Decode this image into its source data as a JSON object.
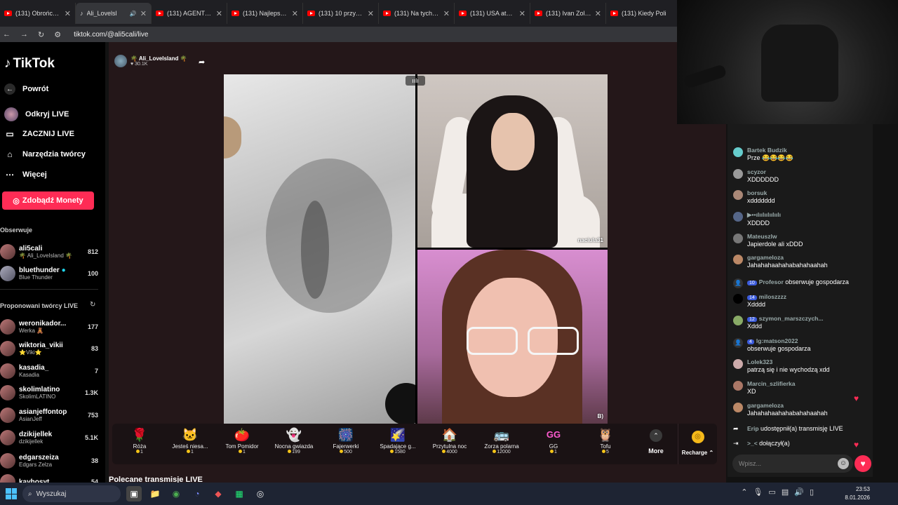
{
  "browser": {
    "tabs": [
      {
        "title": "(131) Obrońcy W",
        "type": "youtube",
        "active": false
      },
      {
        "title": "Ali_Lovelsl",
        "type": "tiktok",
        "active": true
      },
      {
        "title": "(131) AGENT ICE",
        "type": "youtube",
        "active": false
      },
      {
        "title": "(131) Najlepsze T",
        "type": "youtube",
        "active": false
      },
      {
        "title": "(131) 10 przywód",
        "type": "youtube",
        "active": false
      },
      {
        "title": "(131) Na tych prz",
        "type": "youtube",
        "active": false
      },
      {
        "title": "(131) USA atakuj",
        "type": "youtube",
        "active": false
      },
      {
        "title": "(131) Ivan Zolo B",
        "type": "youtube",
        "active": false
      },
      {
        "title": "(131) Kiedy Poli",
        "type": "youtube",
        "active": false
      }
    ],
    "url": "tiktok.com/@ali5cali/live"
  },
  "sidebar": {
    "logo": "TikTok",
    "back": "Powrót",
    "nav": [
      {
        "label": "Odkryj LIVE",
        "icon": "live-avatar-icon"
      },
      {
        "label": "ZACZNIJ LIVE",
        "icon": "video-camera-icon"
      },
      {
        "label": "Narzędzia twórcy",
        "icon": "house-icon"
      },
      {
        "label": "Więcej",
        "icon": "more-dots-icon"
      }
    ],
    "coins_button": "Zdobądź Monety",
    "following_title": "Obserwuje",
    "following": [
      {
        "name": "ali5cali",
        "sub": "🌴 Ali_LoveIsland 🌴",
        "count": "812"
      },
      {
        "name": "bluethunder",
        "sub": "Blue Thunder",
        "count": "100"
      }
    ],
    "suggested_title": "Proponowani twórcy LIVE",
    "suggested": [
      {
        "name": "weronikador...",
        "sub": "Werka 🧸",
        "count": "177"
      },
      {
        "name": "wiktoria_vikii",
        "sub": "⭐Viki⭐",
        "count": "83"
      },
      {
        "name": "kasadia_",
        "sub": "Kasadia",
        "count": "7"
      },
      {
        "name": "skolimlatino",
        "sub": "SkolimLATINO",
        "count": "1.3K"
      },
      {
        "name": "asianjeffontop",
        "sub": "AsianJeff",
        "count": "753"
      },
      {
        "name": "dzikijellek",
        "sub": "dzikijellek",
        "count": "5.1K"
      },
      {
        "name": "edgarszeiza",
        "sub": "Edgars Zelza",
        "count": "38"
      },
      {
        "name": "kayhosyt",
        "sub": "",
        "count": "54"
      }
    ]
  },
  "stream": {
    "host_name": "🌴 Ali_LoveIsland 🌴",
    "viewers": "♥ 30.1K",
    "guest_name": "naciula31",
    "guest2_tag": "B)"
  },
  "gifts": [
    {
      "name": "Róża",
      "price": "1",
      "icon": "🌹"
    },
    {
      "name": "Jesteś niesa...",
      "price": "1",
      "icon": "🐱"
    },
    {
      "name": "Tom Pomidor",
      "price": "1",
      "icon": "🍅"
    },
    {
      "name": "Nocna gwiazda",
      "price": "199",
      "icon": "👻"
    },
    {
      "name": "Fajerwerki",
      "price": "500",
      "icon": "🎆"
    },
    {
      "name": "Spadające g...",
      "price": "1580",
      "icon": "🌠"
    },
    {
      "name": "Przytulna noc",
      "price": "4000",
      "icon": "🏠"
    },
    {
      "name": "Zorza polarna",
      "price": "12000",
      "icon": "🚌"
    },
    {
      "name": "GG",
      "price": "1",
      "icon": "GG"
    },
    {
      "name": "Tofu",
      "price": "5",
      "icon": "🦉"
    }
  ],
  "gift_more": "More",
  "recharge": "Recharge",
  "recommended_title": "Polecane transmisje LIVE",
  "chat": {
    "messages": [
      {
        "user": "Bartek Budzik",
        "text": "Prze 😂😂😂😂",
        "badge": ""
      },
      {
        "user": "scyzor",
        "text": "XDDDDDD",
        "badge": ""
      },
      {
        "user": "borsuk",
        "text": "xddddddd",
        "badge": ""
      },
      {
        "user": "▶▪▪ılıılıılıılıılı",
        "text": "XDDDD",
        "badge": ""
      },
      {
        "user": "Mateuszlw",
        "text": "Japierdole ali xDDD",
        "badge": ""
      },
      {
        "user": "gargameloza",
        "text": "Jahahahaahahabahahaahah",
        "badge": ""
      },
      {
        "user": "Profesor",
        "text": "obserwuje gospodarza",
        "badge": "10",
        "inline": true
      },
      {
        "user": "miloszzzz",
        "text": "Xdddd",
        "badge": "14"
      },
      {
        "user": "szymon_marszczych...",
        "text": "Xddd",
        "badge": "12"
      },
      {
        "user": "lg:matson2022",
        "text": "obserwuje gospodarza",
        "badge": "4"
      },
      {
        "user": "Lolek323",
        "text": "patrzą się i nie wychodzą xdd",
        "badge": ""
      },
      {
        "user": "Marcin_szlifierka",
        "text": "XD",
        "badge": ""
      },
      {
        "user": "gargameloza",
        "text": "Jahahahaahahabahahaahah",
        "badge": ""
      },
      {
        "user": "Erip",
        "text": "udostępnił(a) transmisję LIVE",
        "badge": "",
        "inline": true
      },
      {
        "user": ">_<",
        "text": "dołączył(a)",
        "badge": "",
        "inline": true
      }
    ],
    "placeholder": "Wpisz..."
  },
  "taskbar": {
    "search": "Wyszukaj",
    "time": "23:53",
    "date": "8.01.2026"
  },
  "colors": {
    "accent": "#fe2c55",
    "page_bg": "#121212",
    "stream_bg": "#241719"
  }
}
